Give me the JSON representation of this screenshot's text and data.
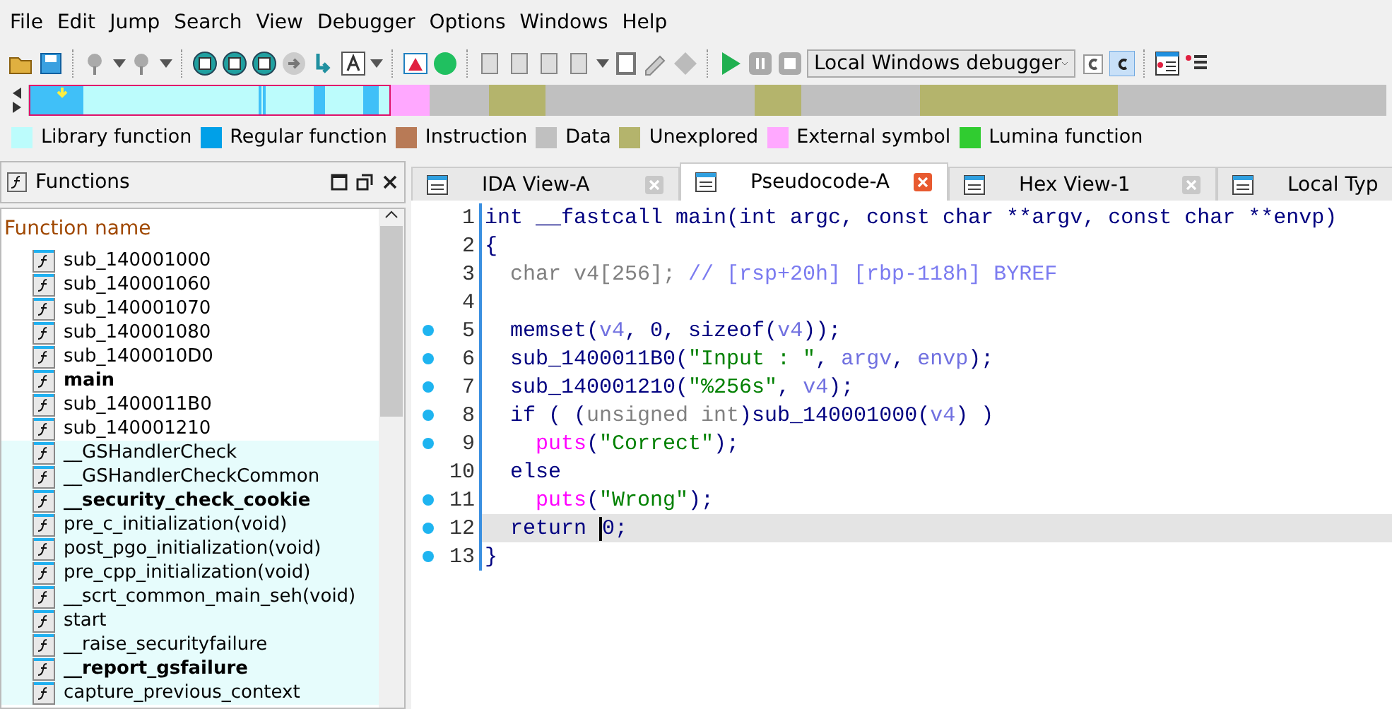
{
  "menu": [
    "File",
    "Edit",
    "Jump",
    "Search",
    "View",
    "Debugger",
    "Options",
    "Windows",
    "Help"
  ],
  "debugger_select": {
    "value": "Local Windows debugger"
  },
  "legend": [
    {
      "label": "Library function",
      "color": "#bcfcfc"
    },
    {
      "label": "Regular function",
      "color": "#00a0e8"
    },
    {
      "label": "Instruction",
      "color": "#b87a56"
    },
    {
      "label": "Data",
      "color": "#c0c0c0"
    },
    {
      "label": "Unexplored",
      "color": "#b4b46c"
    },
    {
      "label": "External symbol",
      "color": "#ffa8ff"
    },
    {
      "label": "Lumina function",
      "color": "#30cc30"
    }
  ],
  "functions_panel": {
    "title": "Functions",
    "column": "Function name",
    "rows": [
      {
        "name": "sub_140001000",
        "bold": false,
        "library": false
      },
      {
        "name": "sub_140001060",
        "bold": false,
        "library": false
      },
      {
        "name": "sub_140001070",
        "bold": false,
        "library": false
      },
      {
        "name": "sub_140001080",
        "bold": false,
        "library": false
      },
      {
        "name": "sub_1400010D0",
        "bold": false,
        "library": false
      },
      {
        "name": "main",
        "bold": true,
        "library": false
      },
      {
        "name": "sub_1400011B0",
        "bold": false,
        "library": false
      },
      {
        "name": "sub_140001210",
        "bold": false,
        "library": false
      },
      {
        "name": "__GSHandlerCheck",
        "bold": false,
        "library": true
      },
      {
        "name": "__GSHandlerCheckCommon",
        "bold": false,
        "library": true
      },
      {
        "name": "__security_check_cookie",
        "bold": true,
        "library": true
      },
      {
        "name": "pre_c_initialization(void)",
        "bold": false,
        "library": true
      },
      {
        "name": "post_pgo_initialization(void)",
        "bold": false,
        "library": true
      },
      {
        "name": "pre_cpp_initialization(void)",
        "bold": false,
        "library": true
      },
      {
        "name": "__scrt_common_main_seh(void)",
        "bold": false,
        "library": true
      },
      {
        "name": "start",
        "bold": false,
        "library": true
      },
      {
        "name": "__raise_securityfailure",
        "bold": false,
        "library": true
      },
      {
        "name": "__report_gsfailure",
        "bold": true,
        "library": true
      },
      {
        "name": "capture_previous_context",
        "bold": false,
        "library": true
      }
    ]
  },
  "tabs": [
    {
      "label": "IDA View-A",
      "selected": false
    },
    {
      "label": "Pseudocode-A",
      "selected": true
    },
    {
      "label": "Hex View-1",
      "selected": false
    },
    {
      "label": "Local Typ",
      "selected": false
    }
  ],
  "code": [
    {
      "number": "1",
      "dot": false,
      "selected": false,
      "tokens": [
        {
          "kind": "kw",
          "text": "int __fastcall main(int argc, const char **argv, const char **envp)"
        }
      ]
    },
    {
      "number": "2",
      "dot": false,
      "selected": false,
      "tokens": [
        {
          "kind": "kw",
          "text": "{"
        }
      ]
    },
    {
      "number": "3",
      "dot": false,
      "selected": false,
      "tokens": [
        {
          "kind": "dim",
          "text": "  char v4[256]; "
        },
        {
          "kind": "cm",
          "text": "// [rsp+20h] [rbp-118h] BYREF"
        }
      ]
    },
    {
      "number": "4",
      "dot": false,
      "selected": false
    },
    {
      "number": "5",
      "dot": true,
      "selected": false,
      "tokens": [
        {
          "kind": "kw",
          "text": "  memset("
        },
        {
          "kind": "var",
          "text": "v4"
        },
        {
          "kind": "kw",
          "text": ", 0, sizeof("
        },
        {
          "kind": "var",
          "text": "v4"
        },
        {
          "kind": "kw",
          "text": "));"
        }
      ]
    },
    {
      "number": "6",
      "dot": true,
      "selected": false,
      "tokens": [
        {
          "kind": "kw",
          "text": "  sub_1400011B0("
        },
        {
          "kind": "str",
          "text": "\"Input : \""
        },
        {
          "kind": "kw",
          "text": ", "
        },
        {
          "kind": "var",
          "text": "argv"
        },
        {
          "kind": "kw",
          "text": ", "
        },
        {
          "kind": "var",
          "text": "envp"
        },
        {
          "kind": "kw",
          "text": ");"
        }
      ]
    },
    {
      "number": "7",
      "dot": true,
      "selected": false,
      "tokens": [
        {
          "kind": "kw",
          "text": "  sub_140001210("
        },
        {
          "kind": "str",
          "text": "\"%256s\""
        },
        {
          "kind": "kw",
          "text": ", "
        },
        {
          "kind": "var",
          "text": "v4"
        },
        {
          "kind": "kw",
          "text": ");"
        }
      ]
    },
    {
      "number": "8",
      "dot": true,
      "selected": false,
      "tokens": [
        {
          "kind": "kw",
          "text": "  if ( ("
        },
        {
          "kind": "dim",
          "text": "unsigned int"
        },
        {
          "kind": "kw",
          "text": ")sub_140001000("
        },
        {
          "kind": "var",
          "text": "v4"
        },
        {
          "kind": "kw",
          "text": ") )"
        }
      ]
    },
    {
      "number": "9",
      "dot": true,
      "selected": false,
      "tokens": [
        {
          "kind": "lib",
          "text": "    puts"
        },
        {
          "kind": "kw",
          "text": "("
        },
        {
          "kind": "str",
          "text": "\"Correct\""
        },
        {
          "kind": "kw",
          "text": ");"
        }
      ]
    },
    {
      "number": "10",
      "dot": false,
      "selected": false,
      "tokens": [
        {
          "kind": "kw",
          "text": "  else"
        }
      ]
    },
    {
      "number": "11",
      "dot": true,
      "selected": false,
      "tokens": [
        {
          "kind": "lib",
          "text": "    puts"
        },
        {
          "kind": "kw",
          "text": "("
        },
        {
          "kind": "str",
          "text": "\"Wrong\""
        },
        {
          "kind": "kw",
          "text": ");"
        }
      ]
    },
    {
      "number": "12",
      "dot": true,
      "selected": true,
      "tokens": [
        {
          "kind": "kw",
          "text": "  return "
        },
        {
          "kind": "cur",
          "text": "0;"
        }
      ]
    },
    {
      "number": "13",
      "dot": true,
      "selected": false,
      "tokens": [
        {
          "kind": "kw",
          "text": "}"
        }
      ]
    }
  ]
}
